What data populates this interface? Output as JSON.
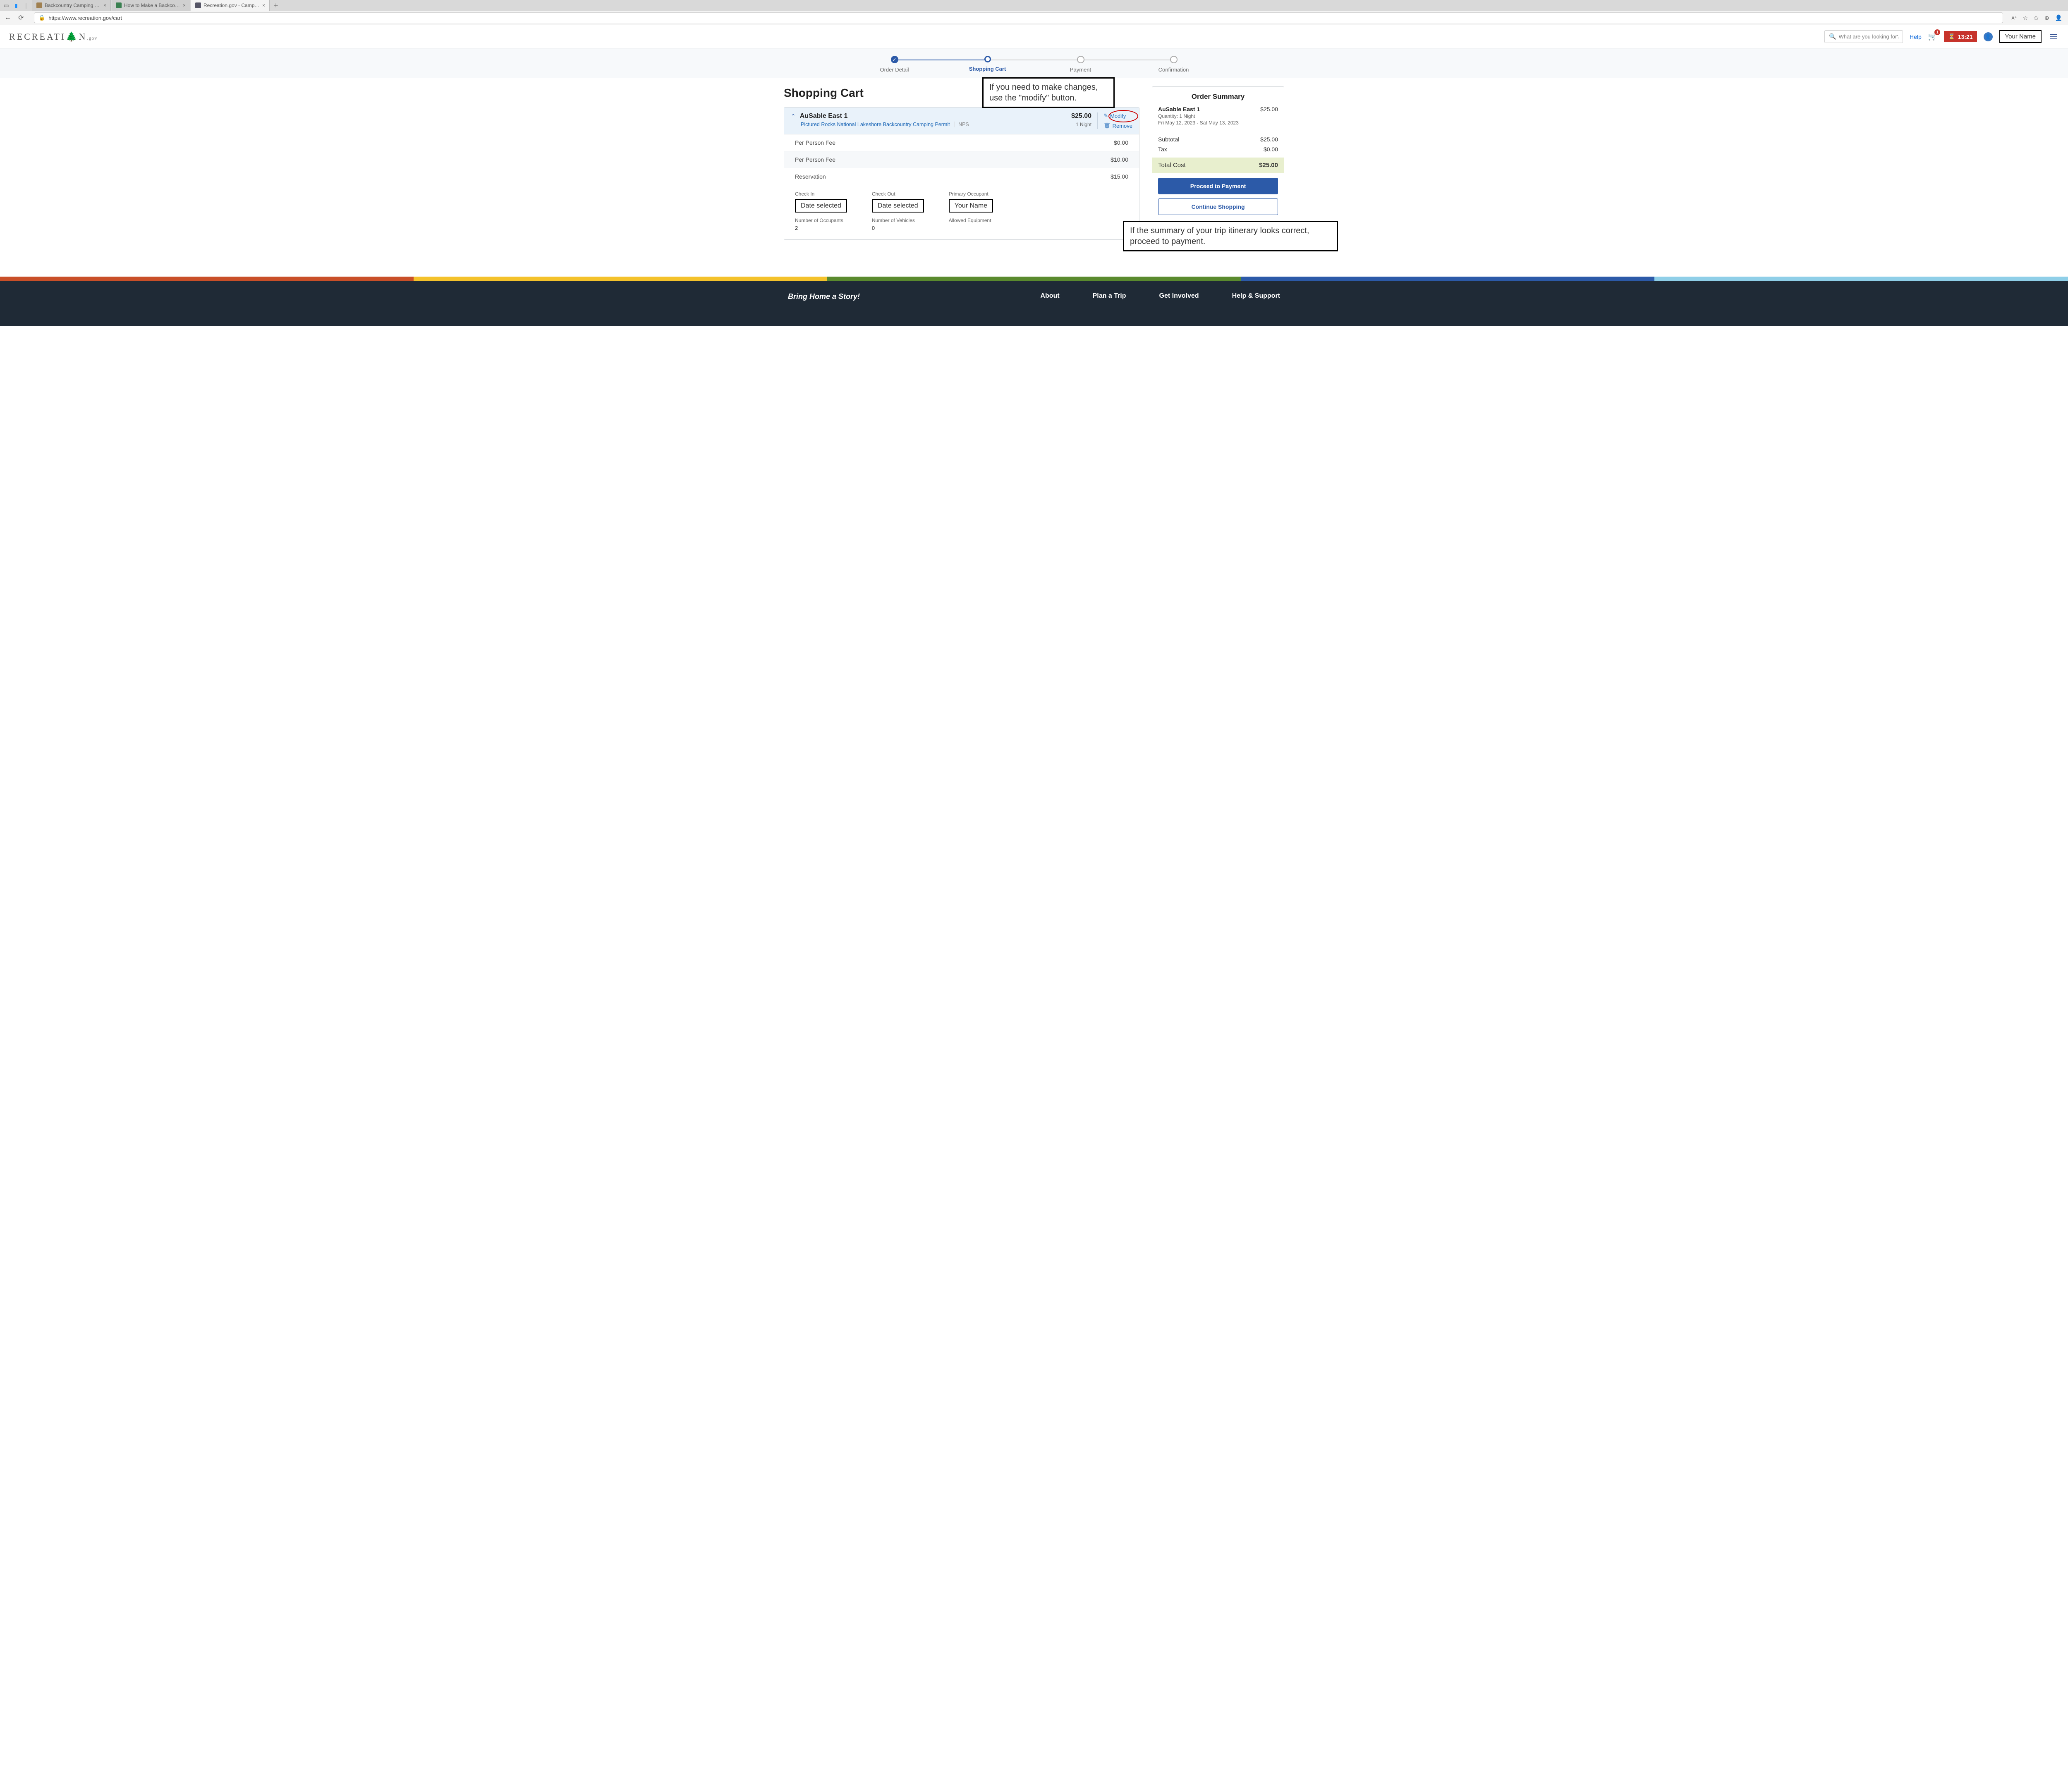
{
  "browser": {
    "tabs": [
      {
        "title": "Backcountry Camping - Pictured"
      },
      {
        "title": "How to Make a Backcountry Cam"
      },
      {
        "title": "Recreation.gov - Camping, Cabin"
      }
    ],
    "url": "https://www.recreation.gov/cart"
  },
  "header": {
    "logo_main": "RECREATI",
    "logo_accent": "O",
    "logo_rest": "N",
    "logo_suffix": ".gov",
    "search_placeholder": "What are you looking for?",
    "help": "Help",
    "cart_count": "1",
    "timer": "13:21",
    "user_name": "Your Name"
  },
  "stepper": {
    "steps": [
      "Order Detail",
      "Shopping Cart",
      "Payment",
      "Confirmation"
    ]
  },
  "page": {
    "title": "Shopping Cart"
  },
  "callouts": {
    "modify": "If you need to make changes, use the \"modify\" button.",
    "proceed": "If the summary of your trip itinerary looks correct, proceed to payment."
  },
  "cart": {
    "item_title": "AuSable East 1",
    "permit_link": "Pictured Rocks National Lakeshore Backcountry Camping Permit",
    "agency": "NPS",
    "price": "$25.00",
    "nights": "1 Night",
    "modify": "Modify",
    "remove": "Remove",
    "lines": [
      {
        "label": "Per Person Fee",
        "value": "$0.00"
      },
      {
        "label": "Per Person Fee",
        "value": "$10.00"
      },
      {
        "label": "Reservation",
        "value": "$15.00"
      }
    ],
    "details": {
      "check_in_label": "Check In",
      "check_in_value": "Date selected",
      "check_out_label": "Check Out",
      "check_out_value": "Date selected",
      "occupant_label": "Primary Occupant",
      "occupant_value": "Your Name",
      "num_occupants_label": "Number of Occupants",
      "num_occupants_value": "2",
      "num_vehicles_label": "Number of Vehicles",
      "num_vehicles_value": "0",
      "equipment_label": "Allowed Equipment"
    }
  },
  "summary": {
    "title": "Order Summary",
    "item_name": "AuSable East 1",
    "item_price": "$25.00",
    "quantity": "Quantity: 1 Night",
    "dates": "Fri May 12, 2023 - Sat May 13, 2023",
    "subtotal_label": "Subtotal",
    "subtotal_value": "$25.00",
    "tax_label": "Tax",
    "tax_value": "$0.00",
    "total_label": "Total Cost",
    "total_value": "$25.00",
    "proceed_btn": "Proceed to Payment",
    "continue_btn": "Continue Shopping"
  },
  "footer": {
    "tagline": "Bring Home a Story!",
    "links": [
      "About",
      "Plan a Trip",
      "Get Involved",
      "Help & Support"
    ],
    "stripe_colors": [
      "#c94f28",
      "#f4c22b",
      "#5a8a2e",
      "#2c5aa8",
      "#8fcfe8"
    ]
  }
}
